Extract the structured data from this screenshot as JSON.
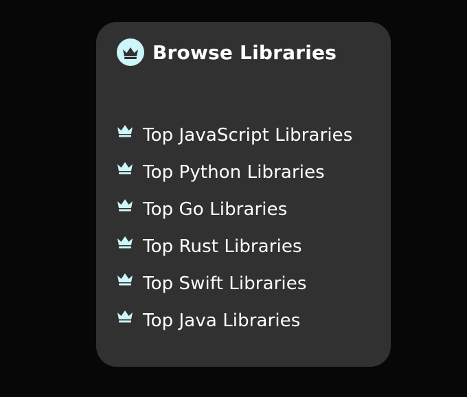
{
  "panel": {
    "title": "Browse Libraries",
    "icon": "crown-icon",
    "accent_color": "#cdf6fb",
    "background_color": "#313131"
  },
  "libraries": [
    {
      "label": "Top JavaScript Libraries",
      "icon": "crown-icon"
    },
    {
      "label": "Top Python Libraries",
      "icon": "crown-icon"
    },
    {
      "label": "Top Go Libraries",
      "icon": "crown-icon"
    },
    {
      "label": "Top Rust Libraries",
      "icon": "crown-icon"
    },
    {
      "label": "Top Swift Libraries",
      "icon": "crown-icon"
    },
    {
      "label": "Top Java Libraries",
      "icon": "crown-icon"
    }
  ]
}
